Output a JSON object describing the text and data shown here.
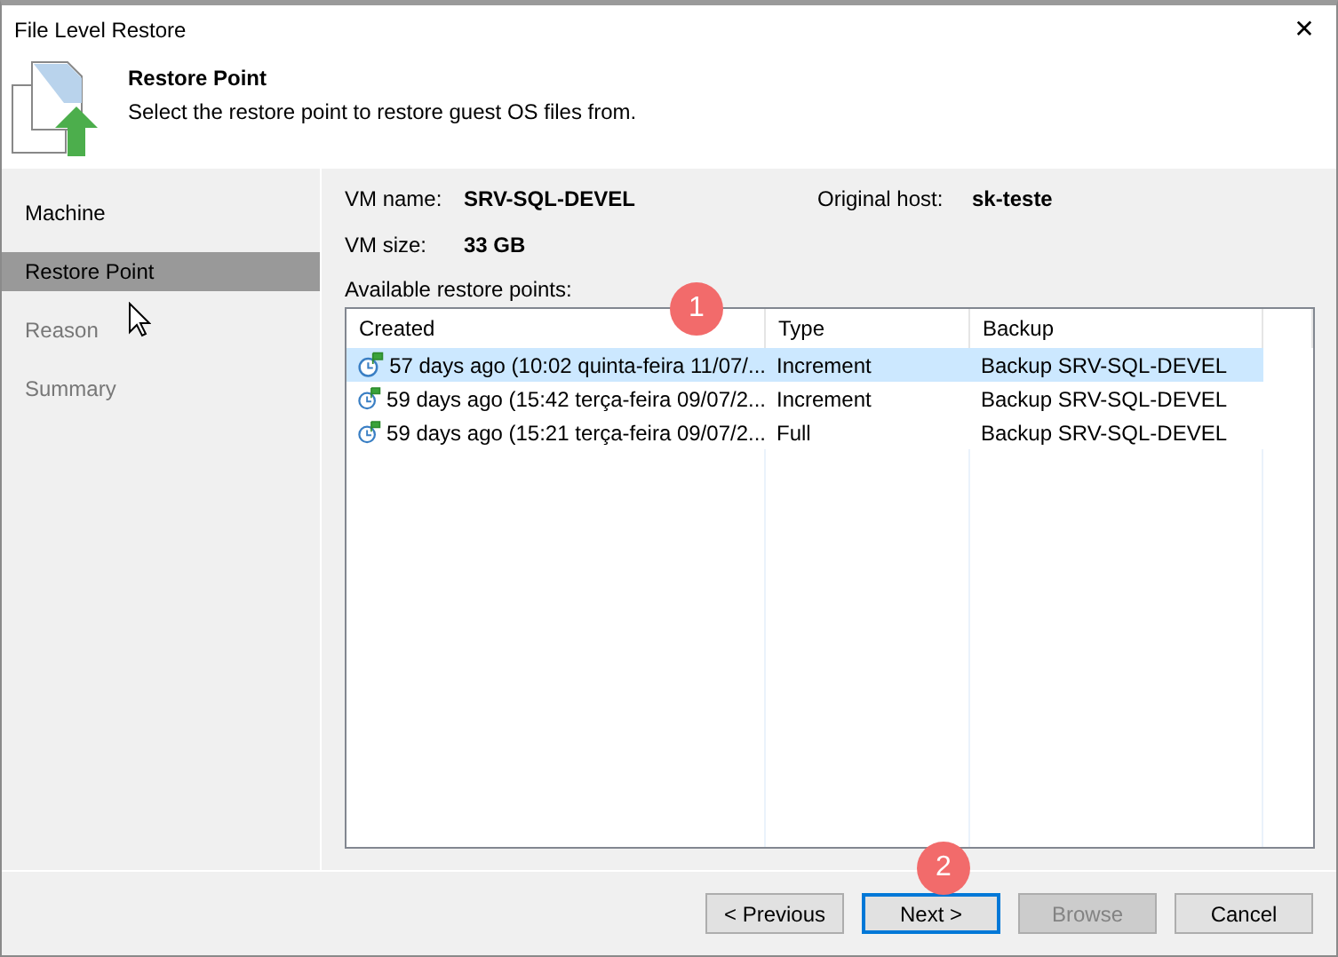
{
  "window": {
    "title": "File Level Restore",
    "close": "✕"
  },
  "header": {
    "title": "Restore Point",
    "subtitle": "Select the restore point to restore guest OS files from."
  },
  "sidebar": {
    "items": [
      {
        "label": "Machine",
        "selected": false,
        "disabled": false
      },
      {
        "label": "Restore Point",
        "selected": true,
        "disabled": false
      },
      {
        "label": "Reason",
        "selected": false,
        "disabled": true
      },
      {
        "label": "Summary",
        "selected": false,
        "disabled": true
      }
    ]
  },
  "info": [
    {
      "label": "VM name:",
      "value": "SRV-SQL-DEVEL"
    },
    {
      "label": "Original host:",
      "value": "sk-teste"
    },
    {
      "label": "VM size:",
      "value": "33 GB"
    }
  ],
  "table": {
    "caption": "Available restore points:",
    "columns": [
      "Created",
      "Type",
      "Backup"
    ],
    "rows": [
      {
        "created": "57 days ago (10:02 quinta-feira 11/07/...",
        "type": "Increment",
        "backup": "Backup SRV-SQL-DEVEL",
        "selected": true
      },
      {
        "created": "59 days ago (15:42 terça-feira 09/07/2...",
        "type": "Increment",
        "backup": "Backup SRV-SQL-DEVEL",
        "selected": false
      },
      {
        "created": "59 days ago (15:21 terça-feira 09/07/2...",
        "type": "Full",
        "backup": "Backup SRV-SQL-DEVEL",
        "selected": false
      }
    ]
  },
  "annotations": [
    "1",
    "2"
  ],
  "buttons": [
    {
      "label": "< Previous",
      "disabled": false,
      "default": false
    },
    {
      "label": "Next >",
      "disabled": false,
      "default": true
    },
    {
      "label": "Browse",
      "disabled": true,
      "default": false
    },
    {
      "label": "Cancel",
      "disabled": false,
      "default": false
    }
  ]
}
